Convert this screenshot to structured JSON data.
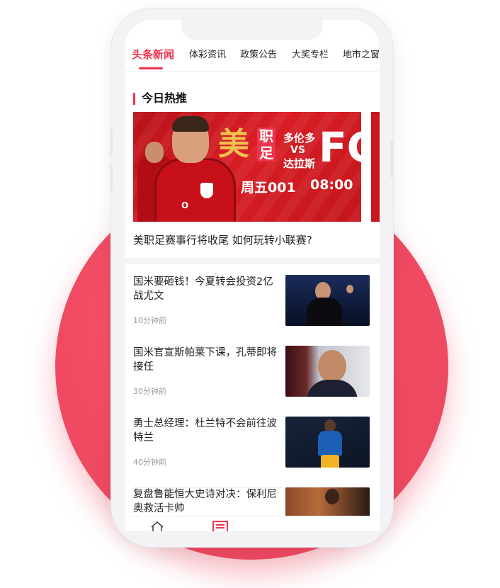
{
  "tabs": [
    {
      "label": "头条新闻",
      "active": true
    },
    {
      "label": "体彩资讯",
      "active": false
    },
    {
      "label": "政策公告",
      "active": false
    },
    {
      "label": "大奖专栏",
      "active": false
    },
    {
      "label": "地市之窗",
      "active": false
    }
  ],
  "section": {
    "title": "今日热推"
  },
  "banner": {
    "big_char": "美",
    "side_chars": "职足",
    "team1": "多伦多",
    "vs": "VS",
    "team2": "达拉斯",
    "fc": "FC",
    "match_no": "周五001",
    "time": "08:00",
    "logo": "O"
  },
  "banner_caption": "美职足赛事行将收尾 如何玩转小联赛?",
  "news": [
    {
      "title": "国米要砸钱！今夏转会投资2亿战尤文",
      "time": "10分钟前",
      "thumb": "coach-celebrating-image"
    },
    {
      "title": "国米官宣斯帕莱下课，孔蒂即将接任",
      "time": "30分钟前",
      "thumb": "coach-portrait-image"
    },
    {
      "title": "勇士总经理：杜兰特不会前往波特兰",
      "time": "40分钟前",
      "thumb": "basketball-player-image"
    },
    {
      "title": "复盘鲁能恒大史诗对决：保利尼奥救活卡帅",
      "time": "",
      "thumb": "football-match-image"
    }
  ],
  "colors": {
    "accent": "#f0344d",
    "blob": "#f04a62"
  }
}
